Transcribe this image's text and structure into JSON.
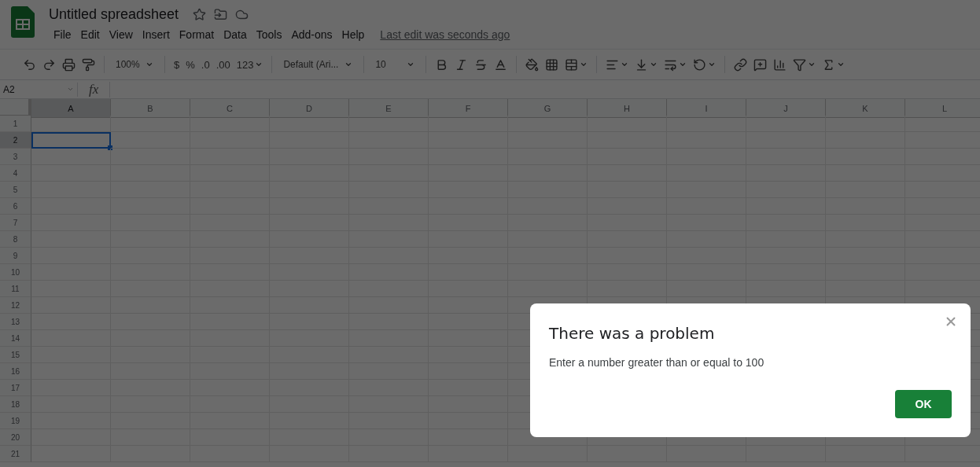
{
  "app": {
    "title": "Untitled spreadsheet",
    "menu": [
      "File",
      "Edit",
      "View",
      "Insert",
      "Format",
      "Data",
      "Tools",
      "Add-ons",
      "Help"
    ],
    "last_edit": "Last edit was seconds ago"
  },
  "toolbar": {
    "zoom": "100%",
    "currency": "$",
    "percent": "%",
    "decrease_decimals": ".0",
    "increase_decimals": ".00",
    "more_formats": "123",
    "font": "Default (Ari...",
    "font_size": "10"
  },
  "formula_bar": {
    "cell_ref": "A2",
    "fx": "fx"
  },
  "sheet": {
    "columns": [
      {
        "label": "A",
        "selected": true
      },
      {
        "label": "B",
        "selected": false
      },
      {
        "label": "C",
        "selected": false
      },
      {
        "label": "D",
        "selected": false
      },
      {
        "label": "E",
        "selected": false
      },
      {
        "label": "F",
        "selected": false
      },
      {
        "label": "G",
        "selected": false
      },
      {
        "label": "H",
        "selected": false
      },
      {
        "label": "I",
        "selected": false
      },
      {
        "label": "J",
        "selected": false
      },
      {
        "label": "K",
        "selected": false
      },
      {
        "label": "L",
        "selected": false
      }
    ],
    "rows": [
      {
        "label": "1",
        "selected": false
      },
      {
        "label": "2",
        "selected": true
      },
      {
        "label": "3",
        "selected": false
      },
      {
        "label": "4",
        "selected": false
      },
      {
        "label": "5",
        "selected": false
      },
      {
        "label": "6",
        "selected": false
      },
      {
        "label": "7",
        "selected": false
      },
      {
        "label": "8",
        "selected": false
      },
      {
        "label": "9",
        "selected": false
      },
      {
        "label": "10",
        "selected": false
      },
      {
        "label": "11",
        "selected": false
      },
      {
        "label": "12",
        "selected": false
      },
      {
        "label": "13",
        "selected": false
      },
      {
        "label": "14",
        "selected": false
      },
      {
        "label": "15",
        "selected": false
      },
      {
        "label": "16",
        "selected": false
      },
      {
        "label": "17",
        "selected": false
      },
      {
        "label": "18",
        "selected": false
      },
      {
        "label": "19",
        "selected": false
      },
      {
        "label": "20",
        "selected": false
      },
      {
        "label": "21",
        "selected": false
      }
    ]
  },
  "dialog": {
    "title": "There was a problem",
    "message": "Enter a number greater than or equal to 100",
    "button": "OK"
  }
}
